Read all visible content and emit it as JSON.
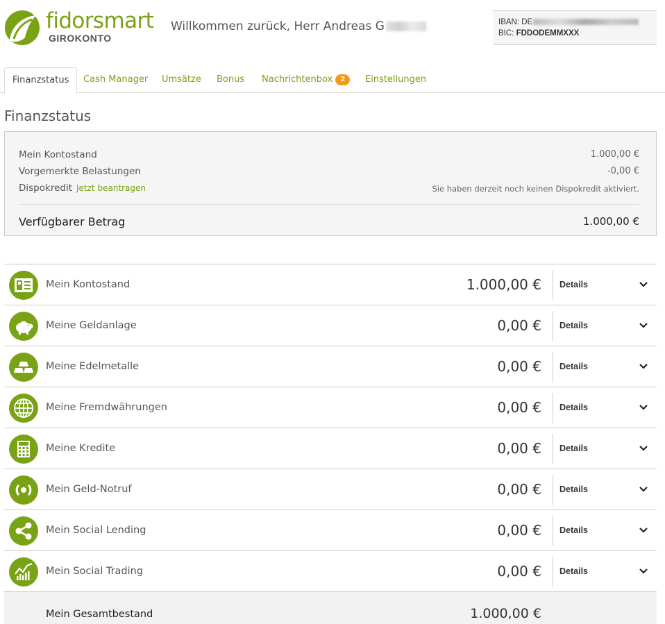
{
  "brand": {
    "name_part1": "fidor",
    "name_part2": "smart",
    "subtitle": "GIROKONTO"
  },
  "header": {
    "welcome": "Willkommen zurück, Herr Andreas G"
  },
  "account": {
    "iban_label": "IBAN: DE",
    "bic_label": "BIC:",
    "bic_value": "FDDODEMMXXX"
  },
  "tabs": [
    {
      "label": "Finanzstatus",
      "active": true
    },
    {
      "label": "Cash Manager"
    },
    {
      "label": "Umsätze"
    },
    {
      "label": "Bonus"
    },
    {
      "label": "Nachrichtenbox",
      "badge": "2"
    },
    {
      "label": "Einstellungen"
    }
  ],
  "page_title": "Finanzstatus",
  "summary": {
    "kontostand_label": "Mein Kontostand",
    "kontostand_value": "1.000,00 €",
    "vorgemerkt_label": "Vorgemerkte Belastungen",
    "vorgemerkt_value": "-0,00 €",
    "dispo_label": "Dispokredit",
    "dispo_link": "Jetzt beantragen",
    "dispo_value": "Sie haben derzeit noch keinen Dispokredit aktiviert.",
    "available_label": "Verfügbarer Betrag",
    "available_value": "1.000,00 €"
  },
  "rows": [
    {
      "label": "Mein Kontostand",
      "amount": "1.000,00 €",
      "details": "Details",
      "icon": "account-card-icon"
    },
    {
      "label": "Meine Geldanlage",
      "amount": "0,00 €",
      "details": "Details",
      "icon": "piggy-bank-icon"
    },
    {
      "label": "Meine Edelmetalle",
      "amount": "0,00 €",
      "details": "Details",
      "icon": "gold-bars-icon"
    },
    {
      "label": "Meine Fremdwährungen",
      "amount": "0,00 €",
      "details": "Details",
      "icon": "globe-icon"
    },
    {
      "label": "Meine Kredite",
      "amount": "0,00 €",
      "details": "Details",
      "icon": "calculator-icon"
    },
    {
      "label": "Mein Geld-Notruf",
      "amount": "0,00 €",
      "details": "Details",
      "icon": "signal-icon"
    },
    {
      "label": "Mein Social Lending",
      "amount": "0,00 €",
      "details": "Details",
      "icon": "share-icon"
    },
    {
      "label": "Mein Social Trading",
      "amount": "0,00 €",
      "details": "Details",
      "icon": "trading-chart-icon"
    }
  ],
  "total": {
    "label": "Mein Gesamtbestand",
    "amount": "1.000,00 €"
  },
  "colors": {
    "brand_green": "#7aa215",
    "badge_orange": "#f39a1b"
  }
}
